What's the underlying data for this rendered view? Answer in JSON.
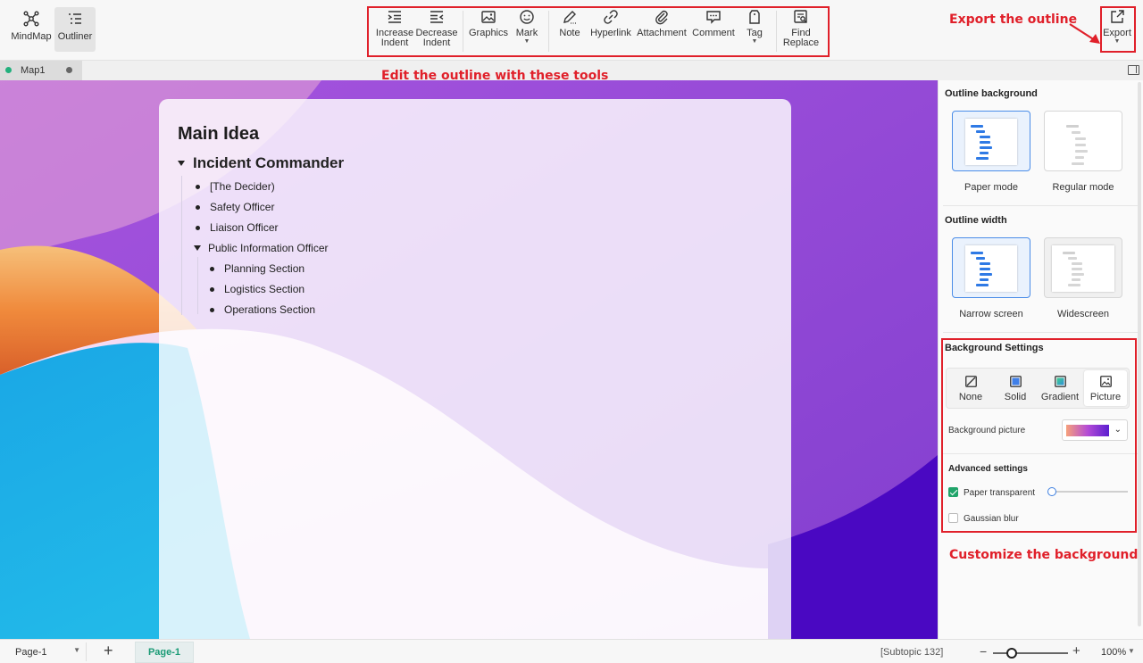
{
  "modes": [
    {
      "label": "MindMap",
      "icon": "mindmap-icon"
    },
    {
      "label": "Outliner",
      "icon": "outliner-icon",
      "active": true
    }
  ],
  "toolbar": {
    "increase_indent": [
      "Increase",
      "Indent"
    ],
    "decrease_indent": [
      "Decrease",
      "Indent"
    ],
    "graphics": "Graphics",
    "mark": "Mark",
    "note": "Note",
    "hyperlink": "Hyperlink",
    "attachment": "Attachment",
    "comment": "Comment",
    "tag": "Tag",
    "find_replace": [
      "Find",
      "Replace"
    ],
    "export": "Export"
  },
  "annotations": {
    "export_note": "Export the outline",
    "tools_note": "Edit the outline with these tools",
    "background_note": "Customize the background",
    "color": "#e0202a"
  },
  "tab": {
    "name": "Map1"
  },
  "outline": {
    "main": "Main Idea",
    "topic": "Incident Commander",
    "items": [
      "[The Decider)",
      "Safety Officer",
      "Liaison Officer",
      "Public Information Officer"
    ],
    "sub_items": [
      "Planning Section",
      "Logistics Section",
      "Operations Section"
    ]
  },
  "panel": {
    "outline_background": {
      "title": "Outline background",
      "options": [
        "Paper mode",
        "Regular mode"
      ],
      "selected": "Paper mode"
    },
    "outline_width": {
      "title": "Outline width",
      "options": [
        "Narrow screen",
        "Widescreen"
      ],
      "selected": "Narrow screen"
    },
    "background_settings": {
      "title": "Background Settings",
      "options": [
        "None",
        "Solid",
        "Gradient",
        "Picture"
      ],
      "selected": "Picture",
      "picture_label": "Background picture"
    },
    "advanced": {
      "title": "Advanced settings",
      "paper_transparent": {
        "label": "Paper transparent",
        "checked": true,
        "value": 0
      },
      "gaussian_blur": {
        "label": "Gaussian blur",
        "checked": false
      }
    }
  },
  "status": {
    "page_select": "Page-1",
    "page_tab": "Page-1",
    "subtopic": "[Subtopic 132]",
    "zoom": "100%"
  },
  "colors": {
    "accent_green": "#1b9b76",
    "selection_blue": "#4b8de8"
  }
}
